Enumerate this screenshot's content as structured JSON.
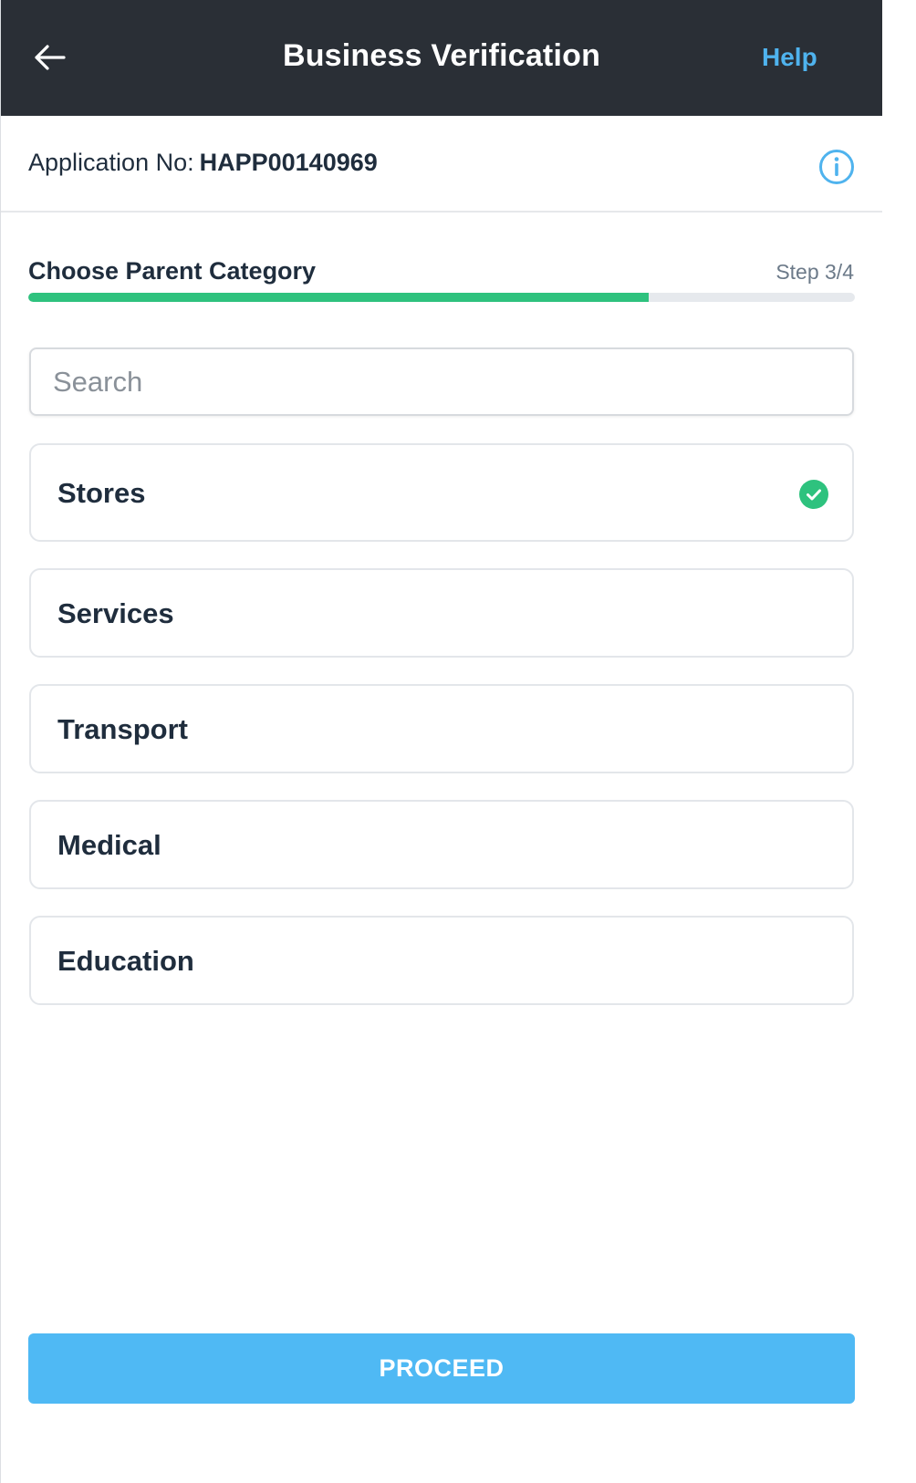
{
  "header": {
    "title": "Business Verification",
    "help_label": "Help"
  },
  "application": {
    "label": "Application No:",
    "number": "HAPP00140969"
  },
  "step": {
    "title": "Choose Parent Category",
    "counter": "Step 3/4",
    "progress_fraction": 0.75
  },
  "search": {
    "placeholder": "Search",
    "value": ""
  },
  "categories": [
    {
      "label": "Stores",
      "selected": true
    },
    {
      "label": "Services",
      "selected": false
    },
    {
      "label": "Transport",
      "selected": false
    },
    {
      "label": "Medical",
      "selected": false
    },
    {
      "label": "Education",
      "selected": false
    }
  ],
  "proceed_label": "PROCEED",
  "colors": {
    "header_bg": "#2a2f36",
    "accent_blue": "#4fb9f4",
    "success_green": "#2ec27e",
    "text_dark": "#1f2d3d"
  }
}
